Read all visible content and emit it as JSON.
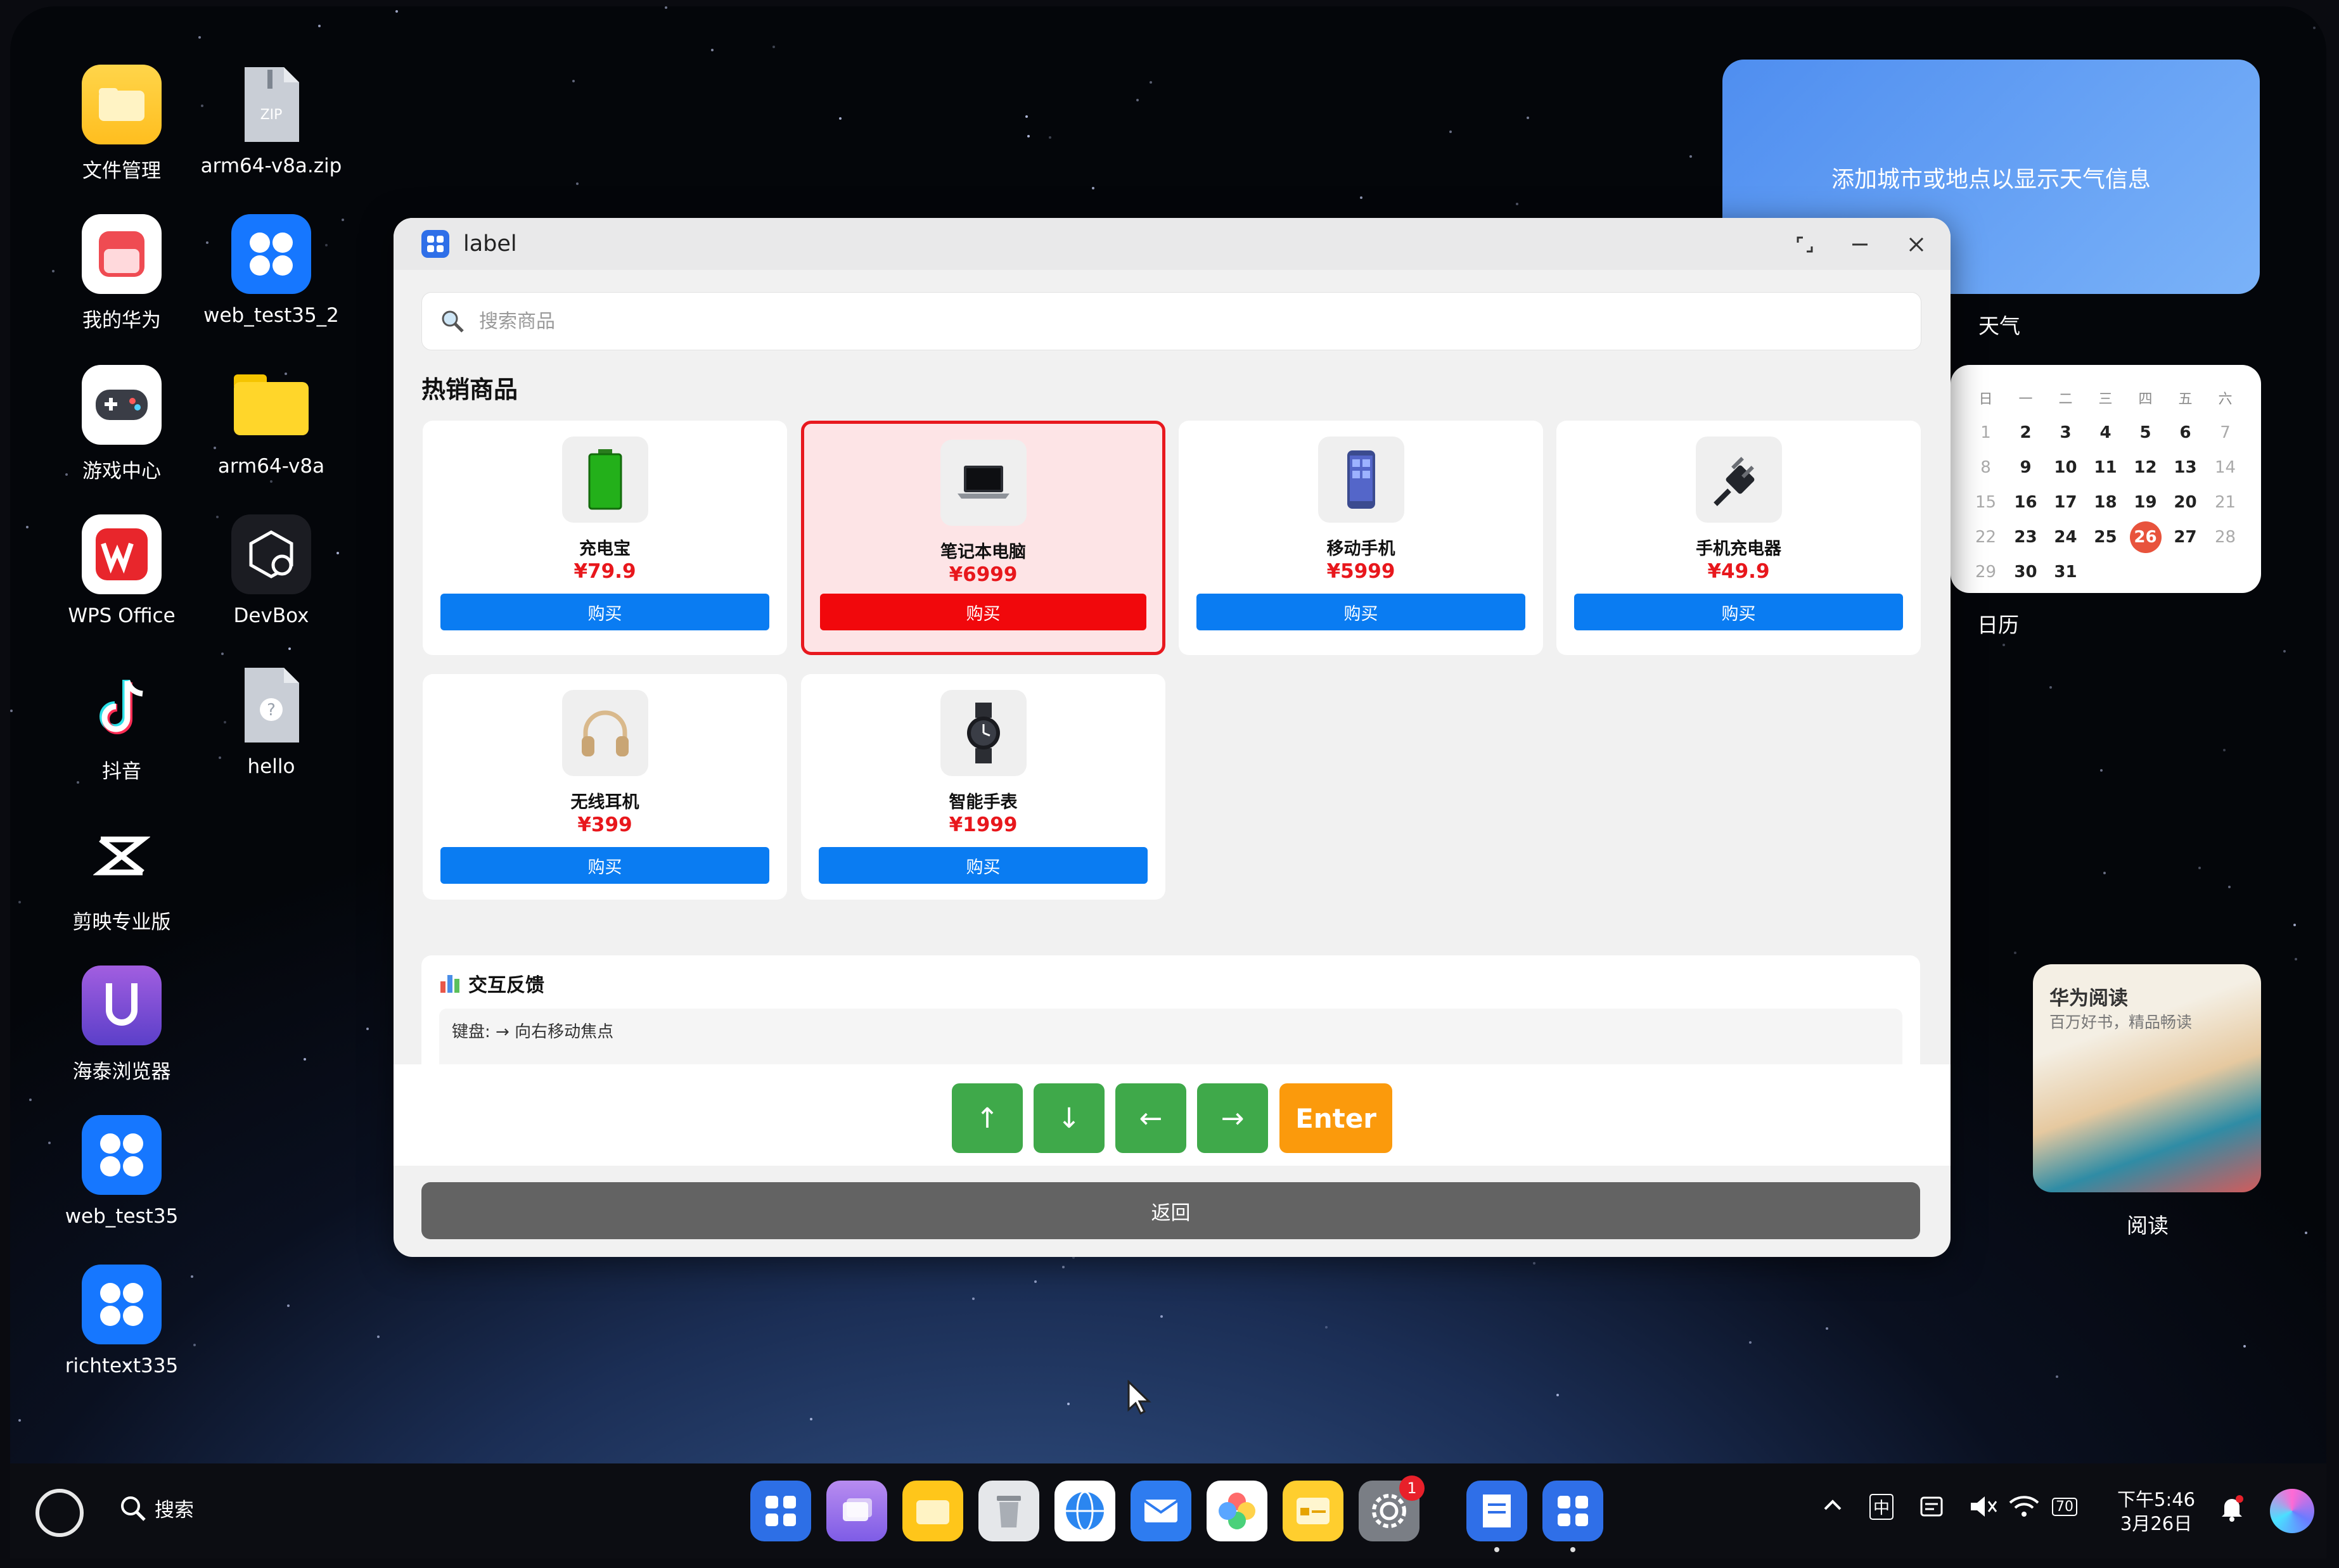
{
  "desktop_icons": [
    {
      "label": "文件管理",
      "icon": "folder-app-icon"
    },
    {
      "label": "arm64-v8a.zip",
      "icon": "zip-file-icon"
    },
    {
      "label": "我的华为",
      "icon": "huawei-app-icon"
    },
    {
      "label": "web_test35_2",
      "icon": "app-grid-icon"
    },
    {
      "label": "游戏中心",
      "icon": "gamepad-icon"
    },
    {
      "label": "arm64-v8a",
      "icon": "folder-icon"
    },
    {
      "label": "WPS Office",
      "icon": "wps-icon"
    },
    {
      "label": "DevBox",
      "icon": "devbox-icon"
    },
    {
      "label": "抖音",
      "icon": "douyin-icon"
    },
    {
      "label": "hello",
      "icon": "unknown-file-icon"
    },
    {
      "label": "剪映专业版",
      "icon": "capcut-icon"
    },
    {
      "label": "海泰浏览器",
      "icon": "browser-icon"
    },
    {
      "label": "web_test35",
      "icon": "app-grid-icon"
    },
    {
      "label": "richtext335",
      "icon": "app-grid-icon"
    }
  ],
  "widgets": {
    "weather": {
      "text": "添加城市或地点以显示天气信息",
      "label": "天气"
    },
    "calendar": {
      "label": "日历",
      "weekdays": [
        "日",
        "一",
        "二",
        "三",
        "四",
        "五",
        "六"
      ],
      "days": [
        "1",
        "2",
        "3",
        "4",
        "5",
        "6",
        "7",
        "8",
        "9",
        "10",
        "11",
        "12",
        "13",
        "14",
        "15",
        "16",
        "17",
        "18",
        "19",
        "20",
        "21",
        "22",
        "23",
        "24",
        "25",
        "26",
        "27",
        "28",
        "29",
        "30",
        "31"
      ],
      "today": "26"
    },
    "reader": {
      "title": "华为阅读",
      "subtitle": "百万好书，精品畅读",
      "label": "阅读"
    }
  },
  "window": {
    "title": "label",
    "search_placeholder": "搜索商品",
    "section_title": "热销商品",
    "products": [
      {
        "name": "充电宝",
        "price": "¥79.9",
        "buy": "购买",
        "icon": "power-bank-icon",
        "focused": false
      },
      {
        "name": "笔记本电脑",
        "price": "¥6999",
        "buy": "购买",
        "icon": "laptop-icon",
        "focused": true
      },
      {
        "name": "移动手机",
        "price": "¥5999",
        "buy": "购买",
        "icon": "phone-icon",
        "focused": false
      },
      {
        "name": "手机充电器",
        "price": "¥49.9",
        "buy": "购买",
        "icon": "charger-plug-icon",
        "focused": false
      },
      {
        "name": "无线耳机",
        "price": "¥399",
        "buy": "购买",
        "icon": "headphones-icon",
        "focused": false
      },
      {
        "name": "智能手表",
        "price": "¥1999",
        "buy": "购买",
        "icon": "smartwatch-icon",
        "focused": false
      }
    ],
    "feedback": {
      "title": "交互反馈",
      "text": "键盘: → 向右移动焦点"
    },
    "keys": {
      "up": "↑",
      "down": "↓",
      "left": "←",
      "right": "→",
      "enter": "Enter"
    },
    "back": "返回"
  },
  "taskbar": {
    "search": "搜索",
    "badge": "1",
    "ime": "中",
    "battery": "70",
    "time": "下午5:46",
    "date": "3月26日"
  },
  "colors": {
    "accent": "#0a7cf2",
    "focus": "#e8181e",
    "price": "#e8171c",
    "key_green": "#3fa94a",
    "key_enter": "#fb9a0c",
    "back": "#636363"
  }
}
